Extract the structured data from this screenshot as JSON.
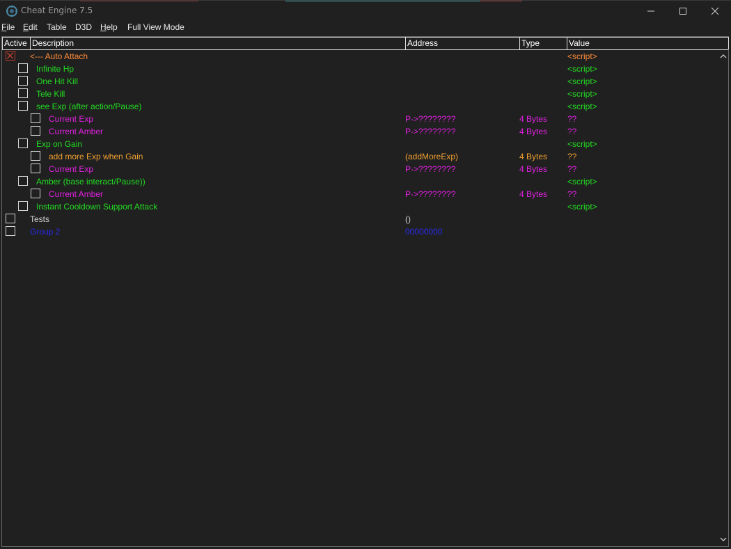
{
  "window": {
    "title": "Cheat Engine 7.5",
    "minimize_glyph": "—",
    "maximize_glyph": "☐",
    "close_glyph": "✕"
  },
  "menu": [
    {
      "label": "File",
      "u": "F",
      "rest": "ile"
    },
    {
      "label": "Edit",
      "u": "E",
      "rest": "dit"
    },
    {
      "label": "Table",
      "u": "",
      "rest": "Table"
    },
    {
      "label": "D3D",
      "u": "",
      "rest": "D3D"
    },
    {
      "label": "Help",
      "u": "H",
      "rest": "elp"
    },
    {
      "label": "Full View Mode",
      "u": "",
      "rest": "Full View Mode"
    }
  ],
  "columns": {
    "active": "Active",
    "description": "Description",
    "address": "Address",
    "type": "Type",
    "value": "Value"
  },
  "colors": {
    "orange": "#ff8c3a",
    "green": "#22dd22",
    "magenta": "#e020e0",
    "gold": "#f0a030",
    "gray": "#d0d0d0",
    "blue": "#2a2af0"
  },
  "rows": [
    {
      "indent": 0,
      "checked": true,
      "description": "<--- Auto Attach",
      "address": "",
      "type": "",
      "value": "<script>",
      "color": "orange",
      "value_color": "orange"
    },
    {
      "indent": 1,
      "checked": false,
      "description": "Infinite Hp",
      "address": "",
      "type": "",
      "value": "<script>",
      "color": "green",
      "value_color": "green"
    },
    {
      "indent": 1,
      "checked": false,
      "description": "One Hit Kill",
      "address": "",
      "type": "",
      "value": "<script>",
      "color": "green",
      "value_color": "green"
    },
    {
      "indent": 1,
      "checked": false,
      "description": "Tele Kill",
      "address": "",
      "type": "",
      "value": "<script>",
      "color": "green",
      "value_color": "green"
    },
    {
      "indent": 1,
      "checked": false,
      "description": "see Exp (after action/Pause)",
      "address": "",
      "type": "",
      "value": "<script>",
      "color": "green",
      "value_color": "green"
    },
    {
      "indent": 2,
      "checked": false,
      "description": "Current Exp",
      "address": "P->????????",
      "type": "4 Bytes",
      "value": "??",
      "color": "magenta",
      "value_color": "magenta"
    },
    {
      "indent": 2,
      "checked": false,
      "description": "Current Amber",
      "address": "P->????????",
      "type": "4 Bytes",
      "value": "??",
      "color": "magenta",
      "value_color": "magenta"
    },
    {
      "indent": 1,
      "checked": false,
      "description": "Exp on Gain",
      "address": "",
      "type": "",
      "value": "<script>",
      "color": "green",
      "value_color": "green"
    },
    {
      "indent": 2,
      "checked": false,
      "description": "add more Exp when Gain",
      "address": "(addMoreExp)",
      "type": "4 Bytes",
      "value": "??",
      "color": "gold",
      "value_color": "gold"
    },
    {
      "indent": 2,
      "checked": false,
      "description": "Current Exp",
      "address": "P->????????",
      "type": "4 Bytes",
      "value": "??",
      "color": "magenta",
      "value_color": "magenta"
    },
    {
      "indent": 1,
      "checked": false,
      "description": "Amber (base interact/Pause))",
      "address": "",
      "type": "",
      "value": "<script>",
      "color": "green",
      "value_color": "green"
    },
    {
      "indent": 2,
      "checked": false,
      "description": "Current Amber",
      "address": "P->????????",
      "type": "4 Bytes",
      "value": "??",
      "color": "magenta",
      "value_color": "magenta"
    },
    {
      "indent": 1,
      "checked": false,
      "description": "Instant Cooldown Support Attack",
      "address": "",
      "type": "",
      "value": "<script>",
      "color": "green",
      "value_color": "green"
    },
    {
      "indent": 0,
      "checked": false,
      "description": "Tests",
      "address": "()",
      "type": "",
      "value": "",
      "color": "gray",
      "value_color": "gray"
    },
    {
      "indent": 0,
      "checked": false,
      "description": "Group 2",
      "address": "00000000",
      "type": "",
      "value": "",
      "color": "blue",
      "value_color": "blue"
    }
  ]
}
